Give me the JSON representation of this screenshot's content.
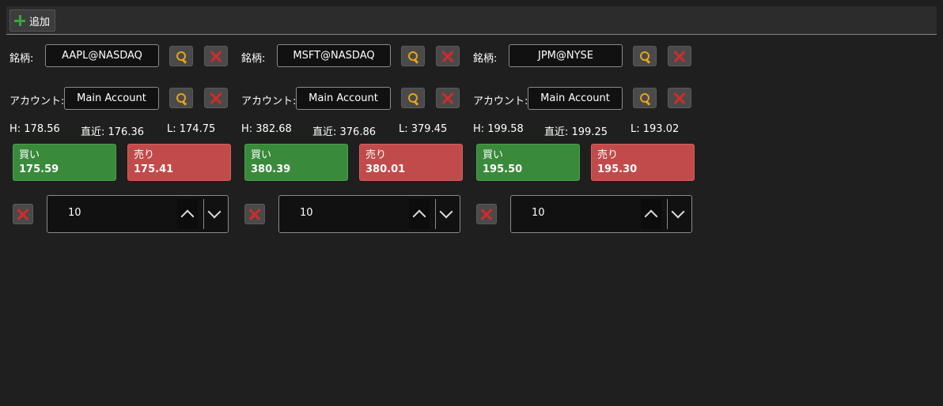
{
  "toolbar": {
    "add_label": "追加"
  },
  "panels": [
    {
      "symbol_label": "銘柄:",
      "symbol": "AAPL@NASDAQ",
      "account_label": "アカウント:",
      "account": "Main Account",
      "high": "H: 178.56",
      "last": "直近: 176.36",
      "low": "L: 174.75",
      "buy_label": "買い",
      "buy_price": "175.59",
      "sell_label": "売り",
      "sell_price": "175.41",
      "quantity": "10"
    },
    {
      "symbol_label": "銘柄:",
      "symbol": "MSFT@NASDAQ",
      "account_label": "アカウント:",
      "account": "Main Account",
      "high": "H: 382.68",
      "last": "直近: 376.86",
      "low": "L: 379.45",
      "buy_label": "買い",
      "buy_price": "380.39",
      "sell_label": "売り",
      "sell_price": "380.01",
      "quantity": "10"
    },
    {
      "symbol_label": "銘柄:",
      "symbol": "JPM@NYSE",
      "account_label": "アカウント:",
      "account": "Main Account",
      "high": "H: 199.58",
      "last": "直近: 199.25",
      "low": "L: 193.02",
      "buy_label": "買い",
      "buy_price": "195.50",
      "sell_label": "売り",
      "sell_price": "195.30",
      "quantity": "10"
    }
  ],
  "colors": {
    "buy": "#3a8a3c",
    "sell": "#c14b4b",
    "search_icon": "#e8a317",
    "remove_icon": "#d42a2a",
    "add_icon": "#3aa53a"
  },
  "icons": {
    "add": "plus-icon",
    "search": "search-icon",
    "remove": "close-icon",
    "spin_up": "chevron-up-icon",
    "spin_down": "chevron-down-icon"
  }
}
